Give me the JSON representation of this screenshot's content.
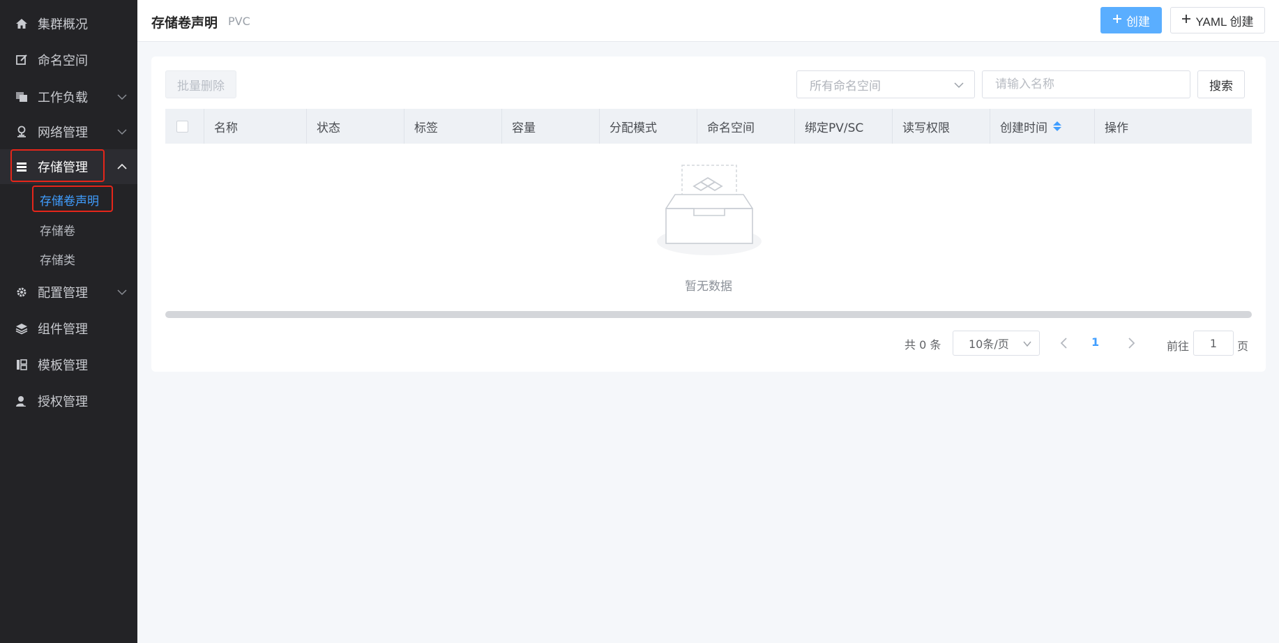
{
  "sidebar": {
    "items": [
      {
        "label": "集群概况",
        "icon": "home-icon"
      },
      {
        "label": "命名空间",
        "icon": "edit-icon"
      },
      {
        "label": "工作负载",
        "icon": "layers-icon"
      },
      {
        "label": "网络管理",
        "icon": "network-icon"
      },
      {
        "label": "存储管理",
        "icon": "storage-icon"
      },
      {
        "label": "配置管理",
        "icon": "gear-icon"
      },
      {
        "label": "组件管理",
        "icon": "stack-icon"
      },
      {
        "label": "模板管理",
        "icon": "template-icon"
      },
      {
        "label": "授权管理",
        "icon": "user-key-icon"
      }
    ],
    "storage_sub": [
      {
        "label": "存储卷声明"
      },
      {
        "label": "存储卷"
      },
      {
        "label": "存储类"
      }
    ],
    "active_item": "存储管理",
    "active_sub": "存储卷声明"
  },
  "header": {
    "title": "存储卷声明",
    "subtitle": "PVC",
    "create_label": "创建",
    "yaml_create_label": "YAML 创建"
  },
  "toolbar": {
    "batch_delete_label": "批量删除",
    "namespace_select": "所有命名空间",
    "name_placeholder": "请输入名称",
    "search_label": "搜索"
  },
  "table": {
    "columns": [
      "名称",
      "状态",
      "标签",
      "容量",
      "分配模式",
      "命名空间",
      "绑定PV/SC",
      "读写权限",
      "创建时间",
      "操作"
    ],
    "rows": [],
    "empty_text": "暂无数据"
  },
  "pagination": {
    "total_text": "共 0 条",
    "page_size": "10条/页",
    "current_page": "1",
    "goto_label": "前往",
    "goto_value": "1",
    "page_suffix": "页"
  },
  "colors": {
    "sidebar_bg": "#232326",
    "accent": "#409eff",
    "create_button": "#5aaeff",
    "highlight_border": "#e5261a"
  }
}
